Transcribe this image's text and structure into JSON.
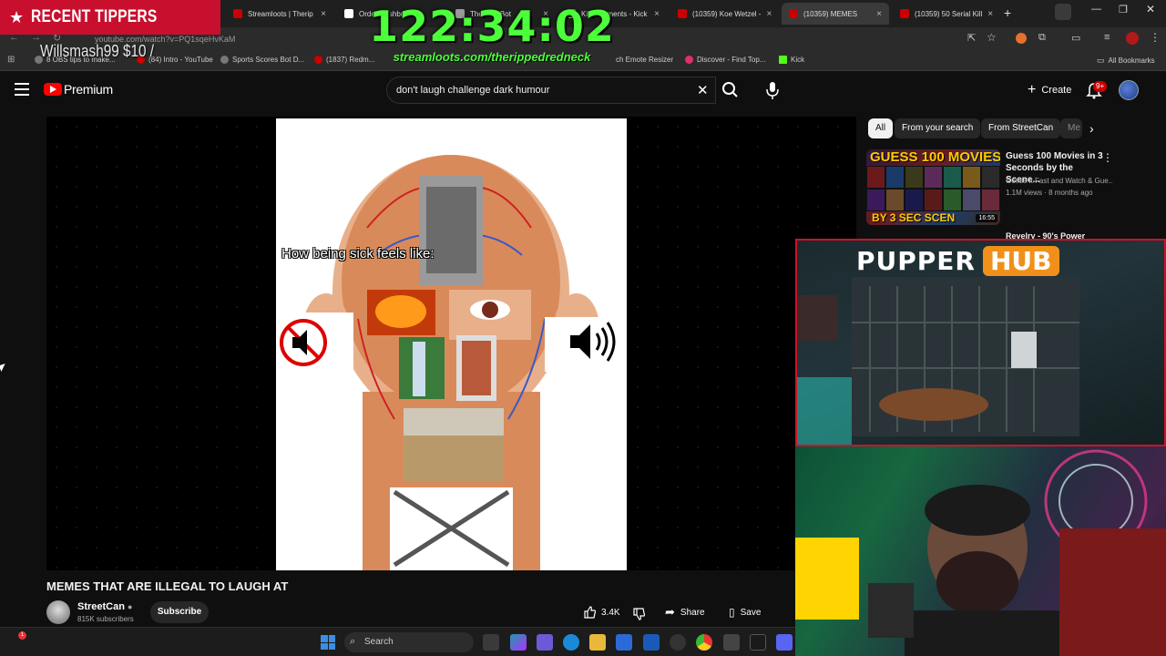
{
  "browser": {
    "tabs": [
      {
        "title": "Streamloots | Therip"
      },
      {
        "title": "Order Dashboard"
      },
      {
        "title": "The ChatBot"
      },
      {
        "title": "Kick Moments - Kick"
      },
      {
        "title": "(10359) Koe Wetzel -"
      },
      {
        "title": "(10359) MEMES"
      },
      {
        "title": "(10359) 50 Serial Kill"
      }
    ],
    "url": "youtube.com/watch?v=PQ1sqeHvKaM",
    "bookmarks": [
      "8 OBS tips to make...",
      "(84) Intro - YouTube",
      "Sports Scores Bot D...",
      "(1837) Redm...",
      "ch Emote Resizer",
      "Discover - Find Top...",
      "Kick",
      "All Bookmarks"
    ]
  },
  "overlay": {
    "recent_tippers_label": "RECENT TIPPERS",
    "tipper_line": "Willsmash99 $10 /",
    "timer": "122:34:02",
    "stream_url": "streamloots.com/therippedredneck",
    "pupper": "PUPPER",
    "hub": "HUB"
  },
  "youtube": {
    "brand": "Premium",
    "search_query": "don't laugh challenge dark humour",
    "create_label": "Create",
    "notification_count": "9+"
  },
  "video": {
    "caption": "How being sick feels like:",
    "title": "MEMES THAT ARE ILLEGAL TO LAUGH AT",
    "channel": "StreetCan",
    "subscribers": "815K subscribers",
    "subscribe_label": "Subscribe",
    "likes": "3.4K",
    "share_label": "Share",
    "save_label": "Save"
  },
  "sidebar": {
    "chips": [
      "All",
      "From your search",
      "From StreetCan",
      "Me"
    ],
    "rec": {
      "thumb_top": "GUESS 100 MOVIES",
      "thumb_bottom": "BY 3 SEC SCEN",
      "duration": "16:55",
      "title": "Guess 100 Movies in 3 Seconds by the Scene...",
      "channel": "Guess It Fast and Watch & Gue...",
      "meta": "1.1M views · 8 months ago"
    },
    "rec2_title": "Revelry - 90's Power"
  },
  "taskbar": {
    "search_label": "Search"
  },
  "colors": {
    "youtube_red": "#ff0000",
    "timer_green": "#4cff3a",
    "tipper_red": "#c8102e",
    "hub_orange": "#f0901a"
  }
}
